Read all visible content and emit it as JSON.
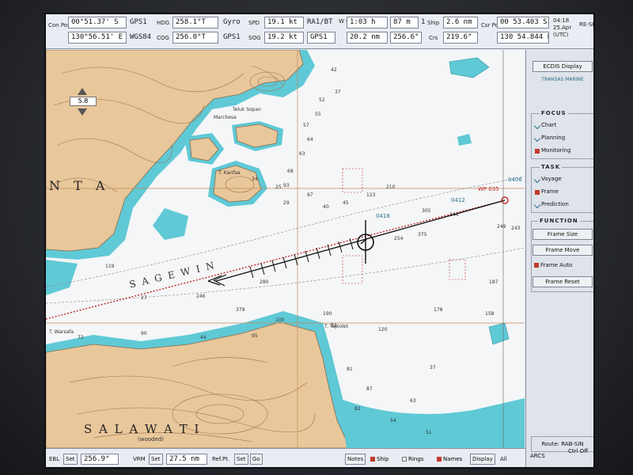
{
  "top_bar": {
    "con_pos_label": "Con Pos",
    "lat": "00°51.37' S",
    "lon": "130°56.51' E",
    "lat_src": "GPS1",
    "datum": "WGS84",
    "hdg_label": "HDG",
    "hdg": "258.1°T",
    "hdg_src": "Gyro",
    "cog_label": "COG",
    "cog": "256.0°T",
    "cog_src": "GPS1",
    "spd_label": "SPD",
    "spd": "19.1 kt",
    "spd_src": "RA1/BT",
    "sog_label": "SOG",
    "sog": "19.2 kt",
    "sog_src": "GPS1",
    "wop_label": "W O P",
    "wop_time": "1:03 h",
    "wop_dist": "20.2 nm",
    "wop_xtd": "87 m",
    "wop_xtd_side": "1",
    "wop_course": "256.6°",
    "ship_label": "Ship",
    "ship_val": "2.6 nm",
    "crs_label": "Crs",
    "crs_val": "219.6°",
    "csr_pos_label": "Csr Pos",
    "csr_lat": "00 53.403 S",
    "csr_lon": "130 54.844 E",
    "date_time": "04:18",
    "date_day": "25.Apr",
    "date_tz": "(UTC)",
    "reset_label": "RE-SET"
  },
  "chart": {
    "scale_value": "5.8",
    "place_nta": "N T A",
    "place_salawati": "S A L A W A T I",
    "place_wooded": "(wooded)",
    "route_name": "S A G E W I N",
    "wp_0418": "0418",
    "wp_0412": "0412",
    "wp_0406": "0406",
    "wp_label": "WP 035",
    "island_marchesa": "Marchesa",
    "cape_tagapo": "T. Kanfaa",
    "cape_tapiolet": "T. Tapiolet",
    "cape_warsafa": "T. Warsafa",
    "bay_label": "Teluk Sopan",
    "soundings": [
      "42",
      "37",
      "52",
      "55",
      "57",
      "64",
      "63",
      "68",
      "93",
      "97",
      "40",
      "45",
      "34",
      "25",
      "29",
      "123",
      "210",
      "305",
      "244",
      "254",
      "375",
      "246",
      "379",
      "190",
      "178",
      "280",
      "72",
      "90",
      "44",
      "95",
      "100",
      "93",
      "120",
      "81",
      "87",
      "82",
      "54",
      "51",
      "63",
      "37",
      "27",
      "119",
      "158",
      "187",
      "249",
      "243"
    ]
  },
  "panel": {
    "ecdis_display": "ECDIS Display",
    "brand": "TRANSAS MARINE",
    "focus_head": "FOCUS",
    "focus_items": [
      "Chart",
      "Planning",
      "Monitoring"
    ],
    "task_head": "TASK",
    "task_items": [
      "Voyage",
      "Frame",
      "Prediction"
    ],
    "function_head": "FUNCTION",
    "frame_size": "Frame Size",
    "frame_move": "Frame Move",
    "frame_auto": "Frame Auto",
    "frame_reset": "Frame Reset",
    "route_label": "Route: RAB-SIN"
  },
  "bottom_bar": {
    "ebl_label": "EBL",
    "ebl_set": "Set",
    "ebl_value": "256.9°",
    "vrm_label": "VRM",
    "vrm_set": "Set",
    "vrm_value": "27.5 nm",
    "refpt_label": "Ref.Pt.",
    "refpt_set": "Set",
    "go_label": "Go",
    "notes": "Notes",
    "ship": "Ship",
    "rings": "Rings",
    "names": "Names",
    "display": "Display",
    "all": "All",
    "arcs": "ARCS",
    "ctrl_off": "Ctrl Off"
  },
  "colors": {
    "land": "#e8c79b",
    "shallow": "#5fc9d6",
    "sea": "#f4f6f7",
    "route": "#c62828",
    "contour": "#a0724a"
  }
}
